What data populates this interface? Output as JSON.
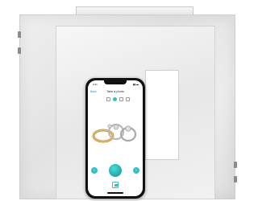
{
  "phone": {
    "time": "9:41",
    "header": {
      "back_label": "Back",
      "title": "Take a photo"
    },
    "modes": [
      "square-icon",
      "circle-icon",
      "grid-icon",
      "frame-icon"
    ],
    "nav": {
      "prev_icon": "chevron-left-icon",
      "next_icon": "chevron-right-icon"
    }
  },
  "colors": {
    "accent": "#2ec2c2",
    "box": "#e6e6e6",
    "phone_body": "#111111"
  }
}
